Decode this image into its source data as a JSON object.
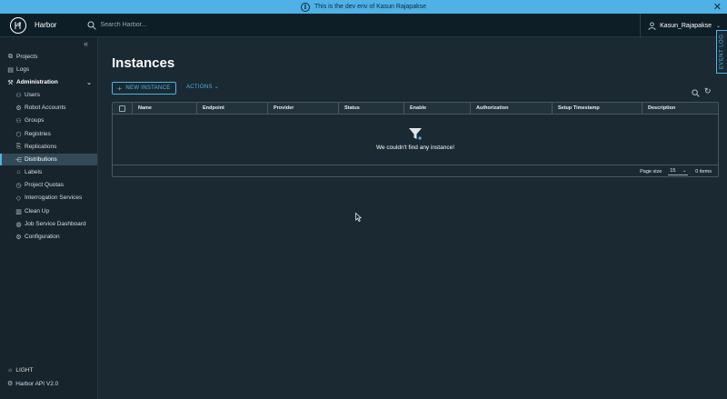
{
  "banner": {
    "text": "This is the dev env of Kasun Rajapakse"
  },
  "header": {
    "brand": "Harbor",
    "search_placeholder": "Search Harbor...",
    "username": "Kasun_Rajapakse"
  },
  "event_log": {
    "label": "EVENT LOG"
  },
  "sidebar": {
    "items": [
      {
        "label": "Projects",
        "icon": "projects-icon",
        "glyph": "⧉"
      },
      {
        "label": "Logs",
        "icon": "logs-icon",
        "glyph": "▤"
      },
      {
        "label": "Administration",
        "icon": "administration-icon",
        "glyph": "⚒"
      },
      {
        "label": "Users",
        "icon": "users-icon",
        "glyph": "⚇"
      },
      {
        "label": "Robot Accounts",
        "icon": "robot-icon",
        "glyph": "⚙"
      },
      {
        "label": "Groups",
        "icon": "groups-icon",
        "glyph": "⚇"
      },
      {
        "label": "Registries",
        "icon": "registries-icon",
        "glyph": "⬡"
      },
      {
        "label": "Replications",
        "icon": "replications-icon",
        "glyph": "⎘"
      },
      {
        "label": "Distributions",
        "icon": "distributions-icon",
        "glyph": "⋲"
      },
      {
        "label": "Labels",
        "icon": "labels-icon",
        "glyph": "⌂"
      },
      {
        "label": "Project Quotas",
        "icon": "quotas-icon",
        "glyph": "◷"
      },
      {
        "label": "Interrogation Services",
        "icon": "shield-icon",
        "glyph": "◇"
      },
      {
        "label": "Clean Up",
        "icon": "trash-icon",
        "glyph": "▥"
      },
      {
        "label": "Job Service Dashboard",
        "icon": "dashboard-icon",
        "glyph": "◍"
      },
      {
        "label": "Configuration",
        "icon": "gear-icon",
        "glyph": "⚙"
      }
    ],
    "active": "Distributions",
    "footer": {
      "theme": "LIGHT",
      "api": "Harbor API V2.0"
    }
  },
  "main": {
    "title": "Instances",
    "new_instance_label": "NEW INSTANCE",
    "actions_label": "ACTIONS",
    "columns": [
      "Name",
      "Endpoint",
      "Provider",
      "Status",
      "Enable",
      "Authorization",
      "Setup Timestamp",
      "Description"
    ],
    "empty_message": "We couldn't find any instance!",
    "page_size_label": "Page size",
    "page_size_value": "15",
    "items_count": "0 items"
  },
  "colors": {
    "accent": "#4fb1e6",
    "background": "#1b2a32",
    "header": "#0e1e26",
    "sidebar": "#17242b"
  }
}
